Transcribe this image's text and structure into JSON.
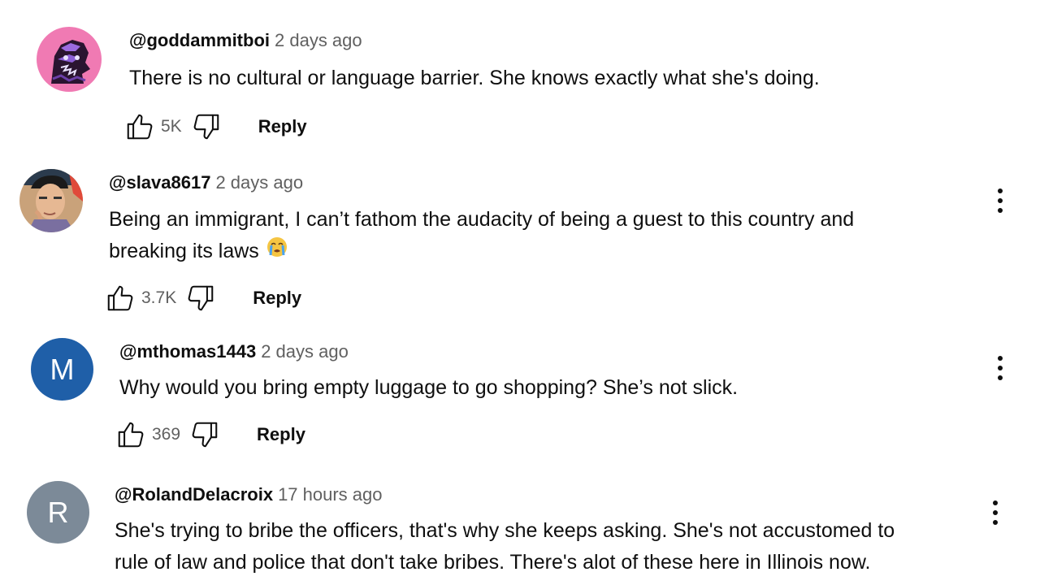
{
  "comments": [
    {
      "handle": "@goddammitboi",
      "time": "2 days ago",
      "lines": [
        "There is no cultural or language barrier. She knows exactly what she's doing."
      ],
      "likes": "5K",
      "reply_label": "Reply",
      "avatar_bg": "#f07ab3"
    },
    {
      "handle": "@slava8617",
      "time": "2 days ago",
      "lines": [
        "Being an immigrant, I can’t fathom the audacity of being a guest to this country and",
        "breaking its laws"
      ],
      "likes": "3.7K",
      "reply_label": "Reply",
      "avatar_bg": "#c9a27a"
    },
    {
      "handle": "@mthomas1443",
      "time": "2 days ago",
      "lines": [
        "Why would you bring empty luggage to go shopping? She’s not slick."
      ],
      "likes": "369",
      "reply_label": "Reply",
      "avatar_letter": "M",
      "avatar_bg": "#1f5fa8"
    },
    {
      "handle": "@RolandDelacroix",
      "time": "17 hours ago",
      "lines": [
        "She's trying to bribe the officers, that's why she keeps asking. She's not accustomed to",
        "rule of law and police that don't take bribes. There's alot of these here in Illinois now."
      ],
      "avatar_letter": "R",
      "avatar_bg": "#7c8a98"
    }
  ],
  "icons": {
    "like": "thumbs-up-icon",
    "dislike": "thumbs-down-icon",
    "menu": "more-vert-icon",
    "emoji": "loudly-crying-face-emoji"
  }
}
